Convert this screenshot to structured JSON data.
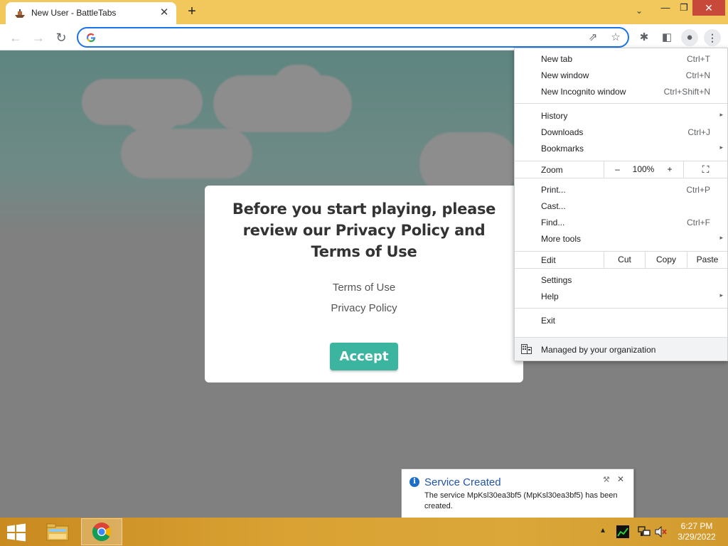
{
  "browser": {
    "tab_title": "New User - BattleTabs",
    "tab_close_icon": "✕",
    "new_tab_icon": "+",
    "tab_search_icon": "⌄",
    "window_controls": {
      "minimize": "—",
      "restore": "❐",
      "close": "✕"
    },
    "nav": {
      "back": "←",
      "forward": "→",
      "reload": "↻"
    },
    "omnibox": {
      "value": "",
      "placeholder": ""
    },
    "toolbar_icons": {
      "share": "⇗",
      "star": "☆",
      "extensions": "✱",
      "sidepanel": "◧",
      "profile": "●",
      "menu": "⋮"
    }
  },
  "page": {
    "modal": {
      "heading": "Before you start playing, please review our Privacy Policy and Terms of Use",
      "terms_link": "Terms of Use",
      "privacy_link": "Privacy Policy",
      "accept_label": "Accept"
    }
  },
  "menu": {
    "new_tab": {
      "label": "New tab",
      "shortcut": "Ctrl+T"
    },
    "new_window": {
      "label": "New window",
      "shortcut": "Ctrl+N"
    },
    "new_incognito": {
      "label": "New Incognito window",
      "shortcut": "Ctrl+Shift+N"
    },
    "history": {
      "label": "History"
    },
    "downloads": {
      "label": "Downloads",
      "shortcut": "Ctrl+J"
    },
    "bookmarks": {
      "label": "Bookmarks"
    },
    "zoom": {
      "label": "Zoom",
      "minus": "–",
      "level": "100%",
      "plus": "+",
      "fullscreen": "⛶"
    },
    "print": {
      "label": "Print...",
      "shortcut": "Ctrl+P"
    },
    "cast": {
      "label": "Cast..."
    },
    "find": {
      "label": "Find...",
      "shortcut": "Ctrl+F"
    },
    "more_tools": {
      "label": "More tools"
    },
    "edit": {
      "label": "Edit",
      "cut": "Cut",
      "copy": "Copy",
      "paste": "Paste"
    },
    "settings": {
      "label": "Settings"
    },
    "help": {
      "label": "Help"
    },
    "exit": {
      "label": "Exit"
    },
    "managed": {
      "label": "Managed by your organization"
    },
    "submenu_arrow": "▸"
  },
  "notification": {
    "title": "Service Created",
    "text": "The service MpKsl30ea3bf5 (MpKsl30ea3bf5) has been created.",
    "info_icon": "i",
    "pin_icon": "⚒",
    "close_icon": "✕"
  },
  "taskbar": {
    "tray_up_icon": "▴",
    "time": "6:27 PM",
    "date": "3/29/2022"
  }
}
